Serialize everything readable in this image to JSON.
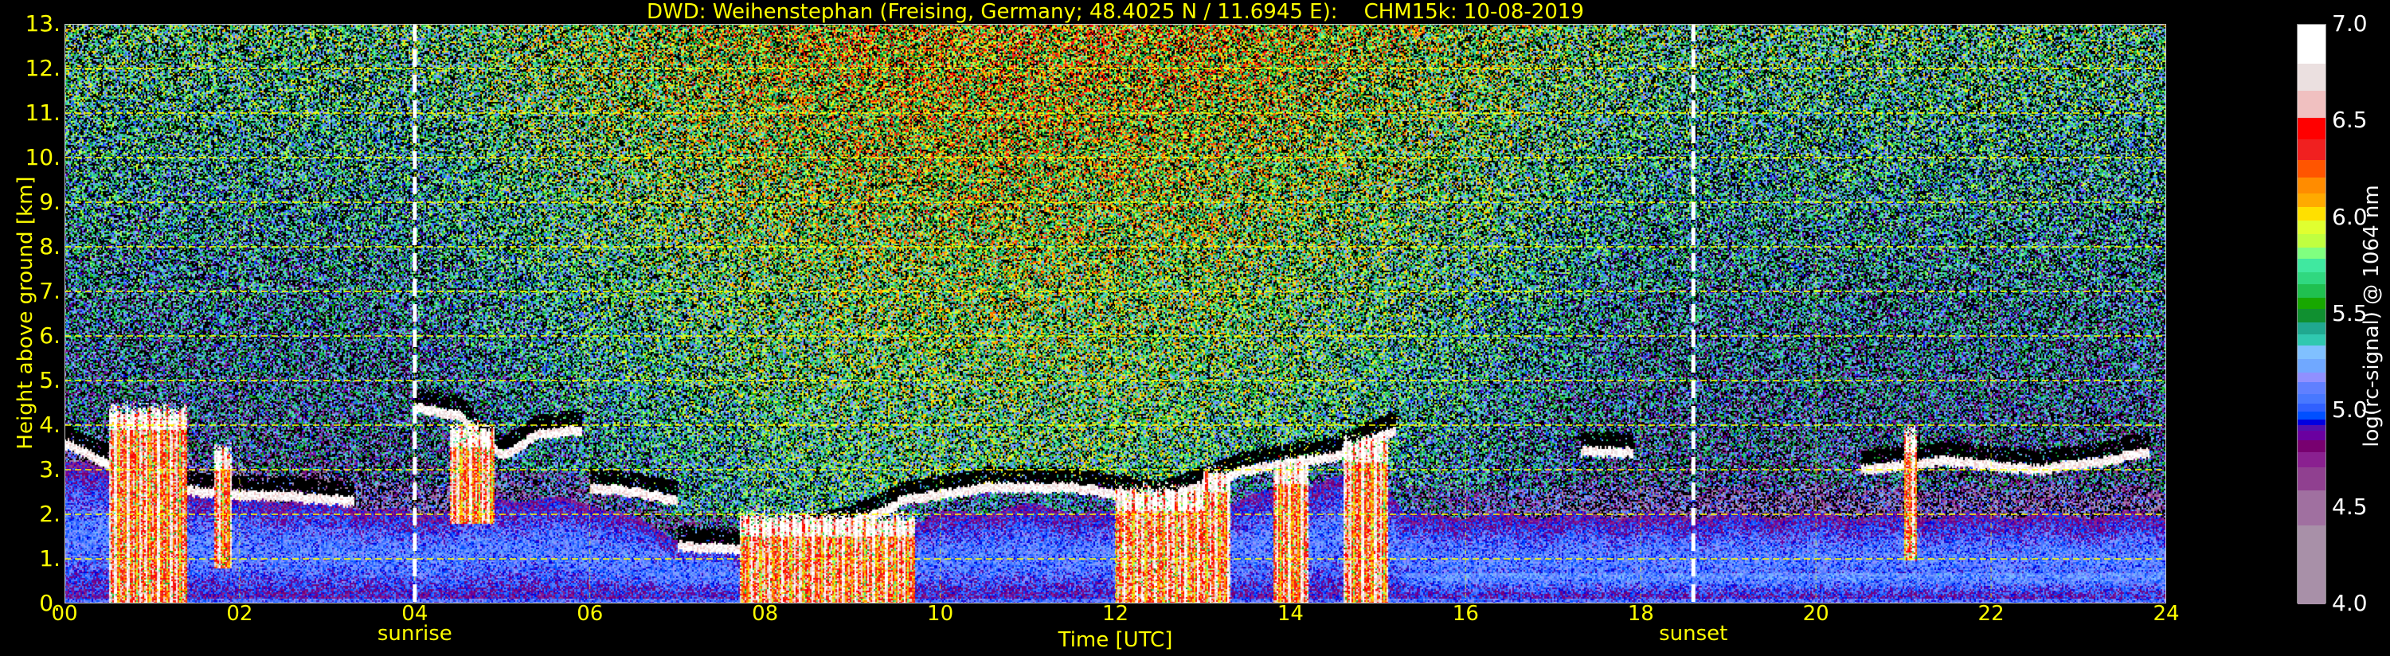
{
  "chart_data": {
    "type": "heatmap",
    "title": "DWD: Weihenstephan (Freising, Germany; 48.4025 N / 11.6945 E):    CHM15k: 10-08-2019",
    "xlabel": "Time [UTC]",
    "ylabel": "Height above ground [km]",
    "xlim": [
      0,
      24
    ],
    "ylim": [
      0,
      13
    ],
    "xticks": [
      0,
      2,
      4,
      6,
      8,
      10,
      12,
      14,
      16,
      18,
      20,
      22,
      24
    ],
    "xtick_labels": [
      "00",
      "02",
      "04",
      "06",
      "08",
      "10",
      "12",
      "14",
      "16",
      "18",
      "20",
      "22",
      "24"
    ],
    "yticks": [
      0,
      1,
      2,
      3,
      4,
      5,
      6,
      7,
      8,
      9,
      10,
      11,
      12,
      13
    ],
    "ytick_labels": [
      "0.",
      "1.",
      "2.",
      "3.",
      "4.",
      "5.",
      "6.",
      "7.",
      "8.",
      "9.",
      "10.",
      "11.",
      "12.",
      "13."
    ],
    "grid": true,
    "annotations": [
      {
        "label": "sunrise",
        "x": 4.0
      },
      {
        "label": "sunset",
        "x": 18.6
      }
    ],
    "colorbar": {
      "label": "log(rc-signal) @ 1064 nm",
      "range": [
        4.0,
        7.0
      ],
      "tick_values": [
        4.0,
        4.5,
        5.0,
        5.5,
        6.0,
        6.5,
        7.0
      ],
      "tick_labels": [
        "4.0",
        "4.5",
        "5.0",
        "5.5",
        "6.0",
        "6.5",
        "7.0"
      ],
      "bounds": [
        4.0,
        4.41,
        4.59,
        4.71,
        4.79,
        4.85,
        4.9,
        4.93,
        4.96,
        5.0,
        5.04,
        5.09,
        5.15,
        5.2,
        5.27,
        5.34,
        5.4,
        5.46,
        5.53,
        5.59,
        5.66,
        5.72,
        5.79,
        5.85,
        5.92,
        5.99,
        6.06,
        6.13,
        6.21,
        6.3,
        6.41,
        6.52,
        6.66,
        6.8,
        7.0
      ],
      "colors": [
        "#a890a8",
        "#a070a0",
        "#904090",
        "#8a2090",
        "#780070",
        "#6a00a0",
        "#5010b0",
        "#0000e0",
        "#0050ff",
        "#3060ff",
        "#4878ff",
        "#6080ff",
        "#9090ff",
        "#70a8ff",
        "#80c0ff",
        "#30c8b0",
        "#20a890",
        "#109030",
        "#18a800",
        "#20c050",
        "#30d880",
        "#40e8a0",
        "#80ff80",
        "#c0ff40",
        "#e0ff30",
        "#ffe000",
        "#ffaa00",
        "#ff8c00",
        "#ff5500",
        "#f02020",
        "#ff0000",
        "#f0c0c0",
        "#ebe0e0",
        "#ffffff"
      ]
    },
    "boundary_layer_top_km": {
      "t": [
        0,
        1,
        2,
        3,
        4,
        5,
        6,
        7,
        8,
        9,
        10,
        11,
        12,
        13,
        14,
        15,
        15.3,
        16,
        18,
        20,
        22,
        24
      ],
      "z": [
        3.2,
        2.8,
        2.4,
        2.3,
        2.0,
        2.4,
        2.3,
        1.5,
        1.2,
        1.6,
        2.0,
        2.2,
        2.0,
        2.2,
        2.6,
        3.0,
        2.0,
        2.0,
        2.0,
        2.0,
        2.0,
        2.0
      ]
    },
    "cloud_base_segments_km": [
      {
        "t": [
          0,
          0.4,
          0.9,
          1.5,
          2.5,
          3.3
        ],
        "z": [
          3.6,
          3.2,
          2.9,
          2.5,
          2.4,
          2.3
        ]
      },
      {
        "t": [
          4.0,
          4.5,
          5.0,
          5.4,
          5.9
        ],
        "z": [
          4.4,
          4.2,
          3.3,
          3.8,
          3.9
        ]
      },
      {
        "t": [
          6.0,
          6.5,
          7.0
        ],
        "z": [
          2.6,
          2.5,
          2.3
        ]
      },
      {
        "t": [
          7.0,
          7.7,
          8.3,
          9.0,
          9.5
        ],
        "z": [
          1.3,
          1.2,
          1.5,
          1.8,
          2.2
        ]
      },
      {
        "t": [
          9.5,
          10.5,
          11.5,
          12.5,
          13.5,
          14.5,
          15.2
        ],
        "z": [
          2.3,
          2.6,
          2.6,
          2.3,
          3.0,
          3.3,
          3.9
        ]
      },
      {
        "t": [
          17.3,
          17.9
        ],
        "z": [
          3.4,
          3.4
        ]
      },
      {
        "t": [
          20.5,
          21.5,
          22.5,
          23.3,
          23.8
        ],
        "z": [
          3.0,
          3.2,
          3.0,
          3.2,
          3.4
        ]
      }
    ],
    "strong_signal_columns": [
      {
        "start": 0.5,
        "end": 1.4,
        "bottom": 0,
        "top": 4.4
      },
      {
        "start": 1.7,
        "end": 1.9,
        "bottom": 0.8,
        "top": 3.5
      },
      {
        "start": 4.4,
        "end": 4.9,
        "bottom": 1.8,
        "top": 4.0
      },
      {
        "start": 7.7,
        "end": 9.7,
        "bottom": 0,
        "top": 2.0
      },
      {
        "start": 12.0,
        "end": 13.0,
        "bottom": 0,
        "top": 2.6
      },
      {
        "start": 13.0,
        "end": 13.3,
        "bottom": 0,
        "top": 3.0
      },
      {
        "start": 13.8,
        "end": 14.2,
        "bottom": 0,
        "top": 3.2
      },
      {
        "start": 14.6,
        "end": 15.1,
        "bottom": 0,
        "top": 3.7
      },
      {
        "start": 21.0,
        "end": 21.15,
        "bottom": 1.0,
        "top": 3.9
      }
    ]
  },
  "colors": {
    "axis_text": "#ffff00",
    "grid": "#ffff00",
    "marker_line": "#ffffff",
    "background": "#000000"
  }
}
